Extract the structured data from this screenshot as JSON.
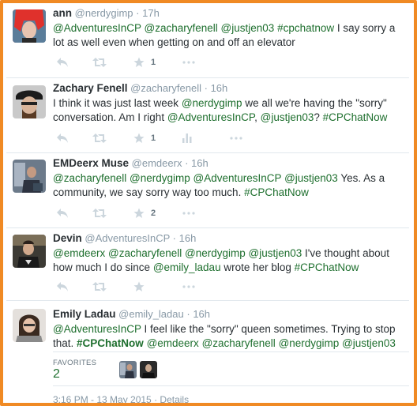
{
  "tweets": [
    {
      "name": "ann",
      "handle": "@nerdygimp",
      "time": "17h",
      "segments": [
        {
          "t": "@AdventuresInCP",
          "link": true
        },
        {
          "t": " "
        },
        {
          "t": "@zacharyfenell",
          "link": true
        },
        {
          "t": " "
        },
        {
          "t": "@justjen03",
          "link": true
        },
        {
          "t": " "
        },
        {
          "t": "#cpchatnow",
          "link": true
        },
        {
          "t": " I say sorry a lot as well even when getting on and off an elevator"
        }
      ],
      "favorites": "1"
    },
    {
      "name": "Zachary Fenell",
      "handle": "@zacharyfenell",
      "time": "16h",
      "segments": [
        {
          "t": "I think it was just last week "
        },
        {
          "t": "@nerdygimp",
          "link": true
        },
        {
          "t": " we all we're having the \"sorry\" conversation. Am I right "
        },
        {
          "t": "@AdventuresInCP",
          "link": true
        },
        {
          "t": ", "
        },
        {
          "t": "@justjen03",
          "link": true
        },
        {
          "t": "? "
        },
        {
          "t": "#CPChatNow",
          "link": true
        }
      ],
      "favorites": "1"
    },
    {
      "name": "EMDeerx Muse",
      "handle": "@emdeerx",
      "time": "16h",
      "segments": [
        {
          "t": "@zacharyfenell",
          "link": true
        },
        {
          "t": " "
        },
        {
          "t": "@nerdygimp",
          "link": true
        },
        {
          "t": " "
        },
        {
          "t": "@AdventuresInCP",
          "link": true
        },
        {
          "t": " "
        },
        {
          "t": "@justjen03",
          "link": true
        },
        {
          "t": " Yes. As a community, we say sorry way too much. "
        },
        {
          "t": "#CPChatNow",
          "link": true
        }
      ],
      "favorites": "2"
    },
    {
      "name": "Devin",
      "handle": "@AdventuresInCP",
      "time": "16h",
      "segments": [
        {
          "t": "@emdeerx",
          "link": true
        },
        {
          "t": " "
        },
        {
          "t": "@zacharyfenell",
          "link": true
        },
        {
          "t": " "
        },
        {
          "t": "@nerdygimp",
          "link": true
        },
        {
          "t": " "
        },
        {
          "t": "@justjen03",
          "link": true
        },
        {
          "t": " I've thought about how much I do since "
        },
        {
          "t": "@emily_ladau",
          "link": true
        },
        {
          "t": " wrote her blog "
        },
        {
          "t": "#CPChatNow",
          "link": true
        }
      ],
      "favorites": ""
    },
    {
      "name": "Emily Ladau",
      "handle": "@emily_ladau",
      "time": "16h",
      "segments": [
        {
          "t": "@AdventuresInCP",
          "link": true
        },
        {
          "t": " I feel like the \"sorry\" queen sometimes. Trying to stop that. "
        },
        {
          "t": "#CPChatNow",
          "link": true,
          "bold": true
        },
        {
          "t": " "
        },
        {
          "t": "@emdeerx",
          "link": true
        },
        {
          "t": " "
        },
        {
          "t": "@zacharyfenell",
          "link": true
        },
        {
          "t": " "
        },
        {
          "t": "@nerdygimp",
          "link": true
        },
        {
          "t": " "
        },
        {
          "t": "@justjen03",
          "link": true
        }
      ],
      "favorites": ""
    }
  ],
  "stats": {
    "favorites_label": "FAVORITES",
    "favorites_count": "2"
  },
  "footer": {
    "meta": "3:16 PM - 13 May 2015 · Details"
  },
  "colors": {
    "frame": "#f08a24",
    "link": "#1e6f2e",
    "muted": "#8899a6",
    "icon": "#ccd6dd"
  }
}
